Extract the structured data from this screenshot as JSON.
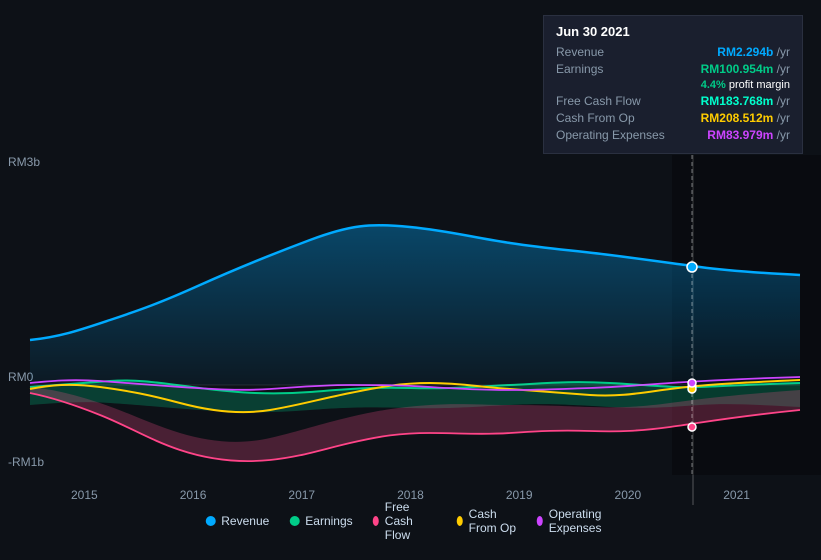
{
  "tooltip": {
    "date": "Jun 30 2021",
    "rows": [
      {
        "label": "Revenue",
        "value": "RM2.294b",
        "unit": "/yr",
        "class": "revenue"
      },
      {
        "label": "Earnings",
        "value": "RM100.954m",
        "unit": "/yr",
        "class": "earnings"
      },
      {
        "margin": "4.4%",
        "text": " profit margin"
      },
      {
        "label": "Free Cash Flow",
        "value": "RM183.768m",
        "unit": "/yr",
        "class": "fcf"
      },
      {
        "label": "Cash From Op",
        "value": "RM208.512m",
        "unit": "/yr",
        "class": "cashop"
      },
      {
        "label": "Operating Expenses",
        "value": "RM83.979m",
        "unit": "/yr",
        "class": "opex"
      }
    ]
  },
  "yAxis": {
    "top": "RM3b",
    "mid": "RM0",
    "bottom": "-RM1b"
  },
  "xAxis": {
    "labels": [
      "2015",
      "2016",
      "2017",
      "2018",
      "2019",
      "2020",
      "2021"
    ]
  },
  "legend": [
    {
      "id": "revenue",
      "label": "Revenue",
      "color": "#00aaff"
    },
    {
      "id": "earnings",
      "label": "Earnings",
      "color": "#00cc88"
    },
    {
      "id": "fcf",
      "label": "Free Cash Flow",
      "color": "#ff6699"
    },
    {
      "id": "cashop",
      "label": "Cash From Op",
      "color": "#ffcc00"
    },
    {
      "id": "opex",
      "label": "Operating Expenses",
      "color": "#cc44ff"
    }
  ]
}
